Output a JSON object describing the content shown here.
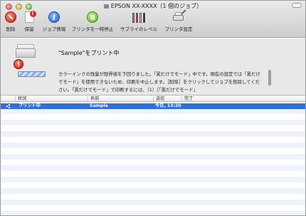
{
  "window": {
    "title": "EPSON XX-XXXX（1 個のジョブ）"
  },
  "toolbar": {
    "items": [
      {
        "label": "削除",
        "icon": "delete-icon"
      },
      {
        "label": "保留",
        "icon": "hold-icon"
      },
      {
        "label": "ジョブ情報",
        "icon": "info-icon"
      },
      {
        "label": "プリンタを一時停止",
        "icon": "pause-icon"
      },
      {
        "label": "サプライのレベル",
        "icon": "supply-levels-icon"
      },
      {
        "label": "プリンタ設定",
        "icon": "printer-settings-icon"
      }
    ]
  },
  "status": {
    "title": "\"Sample\"をプリント中",
    "message": "カラーインクの残量が限界値を下回りました。「黒だけでモード」中です。現在の設定では「黒だけでモード」を使用できないため、印刷を中止します。［削除］をクリックしてジョブを削除してください。「黒だけでモード」で印刷するには、（1）［「黒だけでモード」"
  },
  "table": {
    "columns": [
      "状況",
      "名前",
      "送信",
      "完了"
    ],
    "rows": [
      {
        "status": "プリント中",
        "name": "Sample",
        "sent": "今日, 13:20",
        "completed": ""
      }
    ]
  },
  "colors": {
    "selection": "#2f71d6",
    "stripe": "#eef3fb"
  }
}
